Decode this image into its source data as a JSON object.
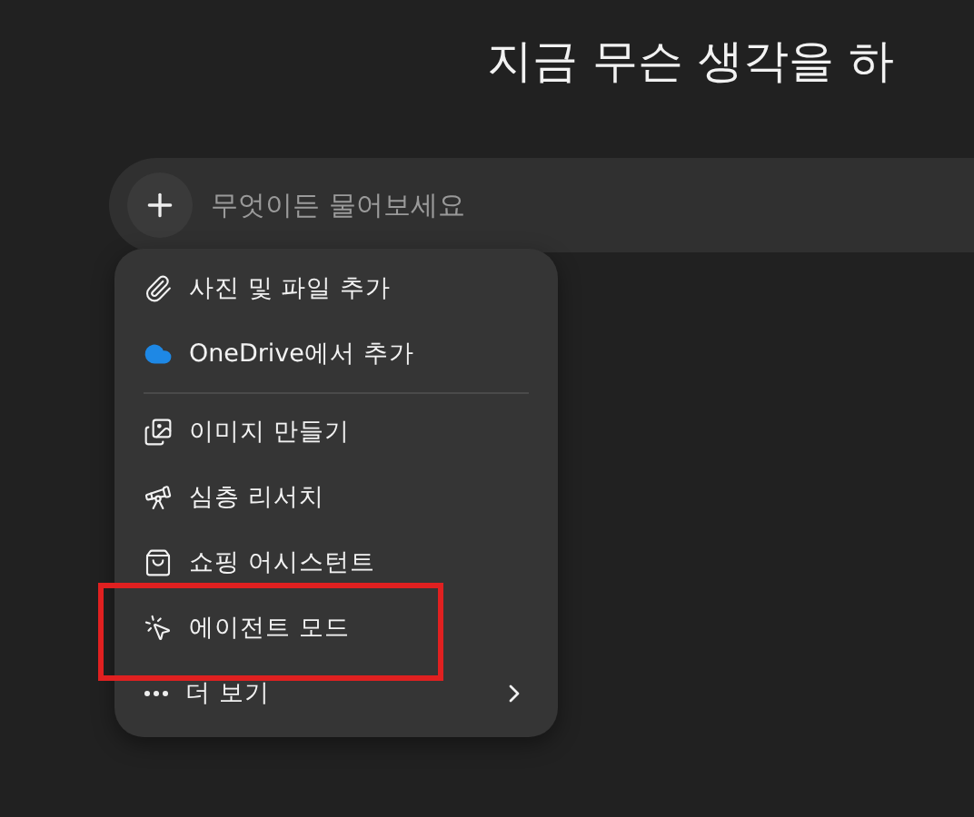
{
  "heading": "지금 무슨 생각을 하",
  "prompt_bar": {
    "placeholder": "무엇이든 물어보세요"
  },
  "menu": {
    "items": [
      {
        "label": "사진 및 파일 추가",
        "kind": "action",
        "highlighted": false
      },
      {
        "label": "OneDrive에서 추가",
        "kind": "action",
        "highlighted": false
      },
      {
        "kind": "divider"
      },
      {
        "label": "이미지 만들기",
        "kind": "action",
        "highlighted": false
      },
      {
        "label": "심층 리서치",
        "kind": "action",
        "highlighted": false
      },
      {
        "label": "쇼핑 어시스턴트",
        "kind": "action",
        "highlighted": false
      },
      {
        "label": "에이전트 모드",
        "kind": "action",
        "highlighted": true
      },
      {
        "label": "더 보기",
        "kind": "submenu",
        "highlighted": false
      }
    ]
  }
}
